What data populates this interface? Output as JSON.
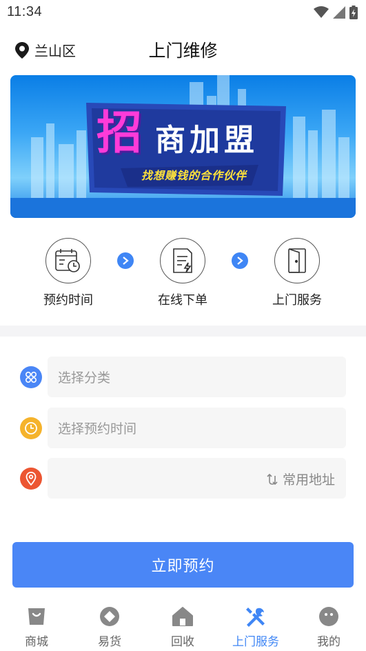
{
  "status_bar": {
    "time": "11:34"
  },
  "header": {
    "location": "兰山区",
    "title": "上门维修"
  },
  "banner": {
    "big_char": "招",
    "headline_rest": "商加盟",
    "subtitle": "找想赚钱的合作伙伴"
  },
  "steps": [
    {
      "label": "预约时间",
      "icon": "calendar-clock-icon"
    },
    {
      "label": "在线下单",
      "icon": "order-form-icon"
    },
    {
      "label": "上门服务",
      "icon": "door-icon"
    }
  ],
  "form": {
    "category_placeholder": "选择分类",
    "time_placeholder": "选择预约时间",
    "address_value": "",
    "address_link": "常用地址"
  },
  "submit_label": "立即预约",
  "tabs": [
    {
      "label": "商城",
      "icon": "shopping-bag-icon",
      "active": false
    },
    {
      "label": "易货",
      "icon": "barter-icon",
      "active": false
    },
    {
      "label": "回收",
      "icon": "home-icon",
      "active": false
    },
    {
      "label": "上门服务",
      "icon": "tools-icon",
      "active": true
    },
    {
      "label": "我的",
      "icon": "profile-face-icon",
      "active": false
    }
  ],
  "colors": {
    "accent": "#4a86f6",
    "category_icon": "#4a86f6",
    "time_icon": "#f5b32c",
    "address_icon": "#ec5632",
    "tab_inactive": "#888888"
  }
}
